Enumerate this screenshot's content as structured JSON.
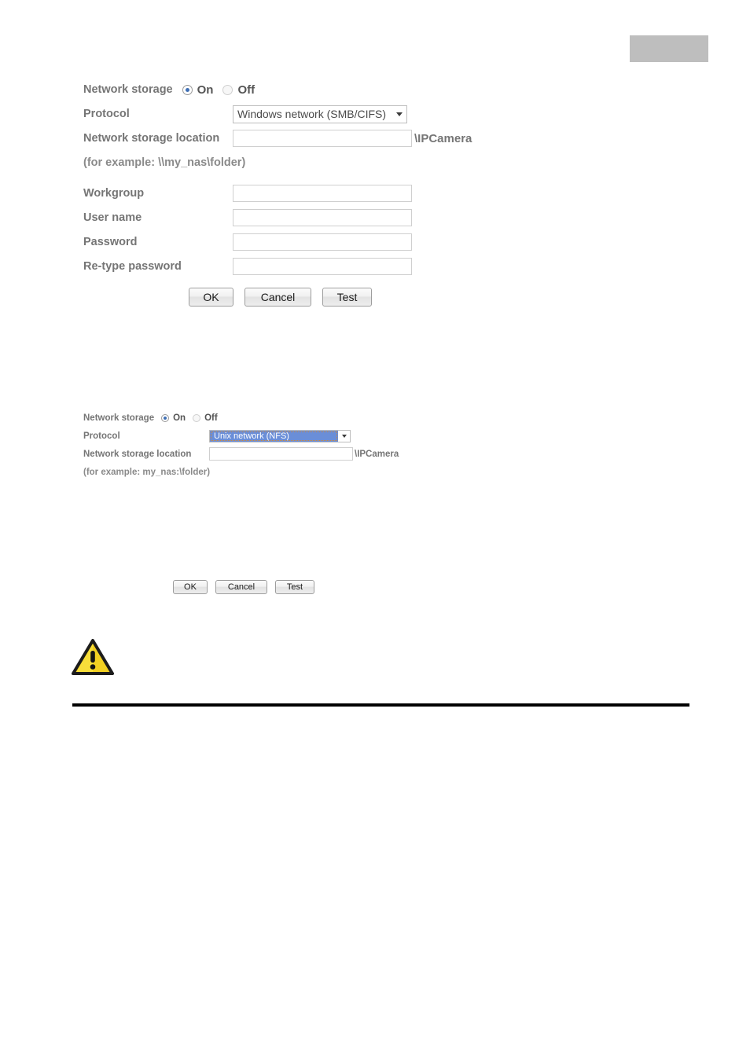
{
  "page": {
    "header_block_color": "#bebebe",
    "footer_rule_color": "#000000"
  },
  "smb_form": {
    "network_storage": {
      "label": "Network storage",
      "options": [
        {
          "label": "On",
          "selected": true
        },
        {
          "label": "Off",
          "selected": false
        }
      ],
      "on_label": "On",
      "off_label": "Off"
    },
    "protocol": {
      "label": "Protocol",
      "value": "Windows network (SMB/CIFS)",
      "options": [
        "Windows network (SMB/CIFS)",
        "Unix network (NFS)"
      ],
      "focused": false
    },
    "storage_location": {
      "label": "Network storage location",
      "value": "",
      "placeholder": "",
      "suffix": "\\IPCamera"
    },
    "example_hint": "(for example: \\\\my_nas\\folder)",
    "workgroup": {
      "label": "Workgroup",
      "value": "",
      "placeholder": ""
    },
    "user_name": {
      "label": "User name",
      "value": "",
      "placeholder": ""
    },
    "password": {
      "label": "Password",
      "value": "",
      "placeholder": ""
    },
    "retype_password": {
      "label": "Re-type password",
      "value": "",
      "placeholder": ""
    },
    "buttons": {
      "ok": "OK",
      "cancel": "Cancel",
      "test": "Test"
    }
  },
  "nfs_form": {
    "network_storage": {
      "label": "Network storage",
      "on_label": "On",
      "off_label": "Off",
      "options": [
        {
          "label": "On",
          "selected": true
        },
        {
          "label": "Off",
          "selected": false
        }
      ]
    },
    "protocol": {
      "label": "Protocol",
      "value": "Unix network (NFS)",
      "options": [
        "Windows network (SMB/CIFS)",
        "Unix network (NFS)"
      ],
      "focused": true,
      "highlight_color": "#6a8ed8"
    },
    "storage_location": {
      "label": "Network storage location",
      "value": "",
      "placeholder": "",
      "suffix": "\\IPCamera"
    },
    "example_hint": "(for example: my_nas:\\folder)",
    "buttons": {
      "ok": "OK",
      "cancel": "Cancel",
      "test": "Test"
    }
  },
  "warning": {
    "icon": "warning-triangle-icon",
    "body_color": "#f5d016",
    "border_color": "#1e1e1e",
    "mark": "!"
  }
}
